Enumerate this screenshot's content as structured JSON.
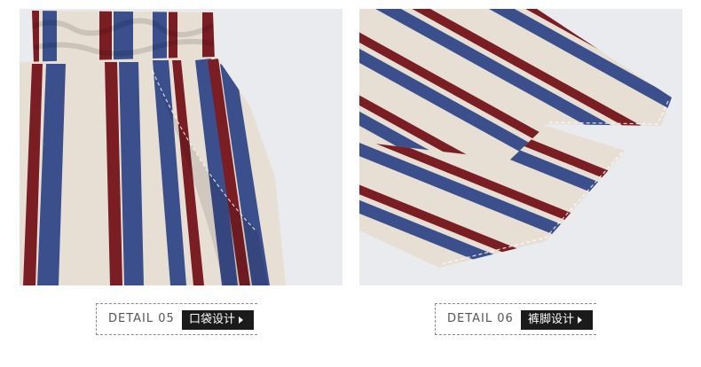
{
  "details": [
    {
      "label": "DETAIL 05",
      "title": "口袋设计"
    },
    {
      "label": "DETAIL 06",
      "title": "裤脚设计"
    }
  ],
  "colors": {
    "background": "#e9ebee",
    "stripe_blue": "#3a4f8c",
    "stripe_red": "#7a1e24",
    "stripe_cream": "#e8dfd4",
    "tag": "#1b1b1b"
  }
}
